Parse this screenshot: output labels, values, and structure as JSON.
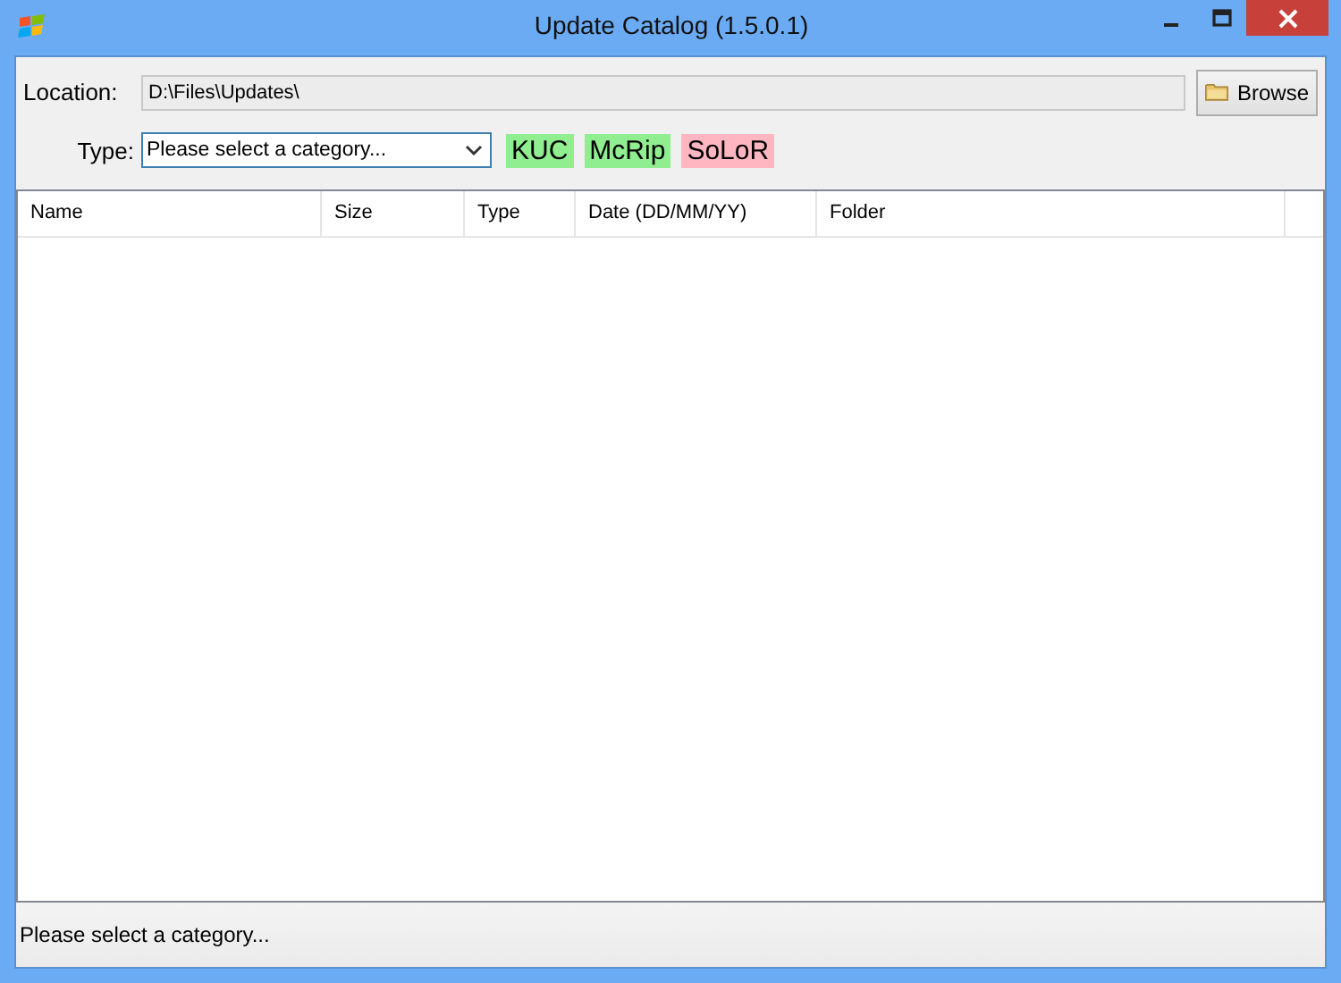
{
  "window": {
    "title": "Update Catalog (1.5.0.1)"
  },
  "location": {
    "label": "Location:",
    "value": "D:\\Files\\Updates\\",
    "button": "Browse"
  },
  "type": {
    "label": "Type:",
    "value": "Please select a category..."
  },
  "tags": [
    {
      "label": "KUC",
      "color": "#90ee90"
    },
    {
      "label": "McRip",
      "color": "#90ee90"
    },
    {
      "label": "SoLoR",
      "color": "#ffb6c1"
    }
  ],
  "table": {
    "columns": [
      "Name",
      "Size",
      "Type",
      "Date (DD/MM/YY)",
      "Folder"
    ]
  },
  "status_bar": "Please select a category..."
}
